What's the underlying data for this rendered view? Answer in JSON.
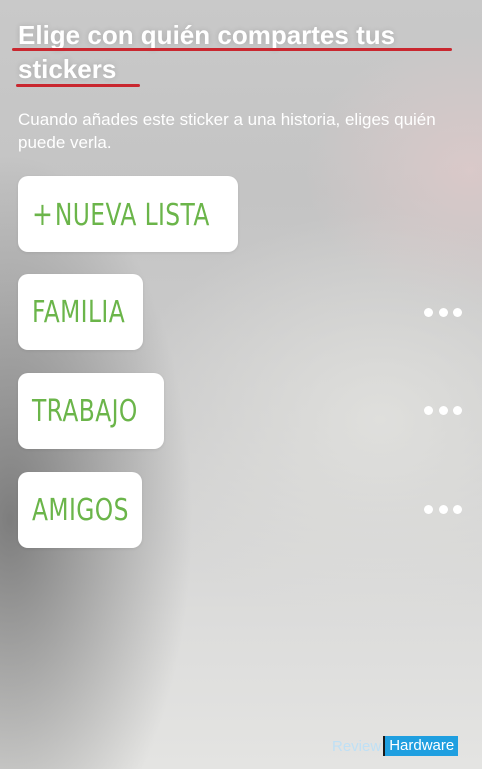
{
  "header": {
    "title": "Elige con quién compartes tus stickers",
    "subtitle": "Cuando añades este sticker a una historia, eliges quién puede verla."
  },
  "new_list_button": {
    "icon": "+",
    "label": "NUEVA LISTA"
  },
  "lists": [
    {
      "label": "FAMILIA"
    },
    {
      "label": "TRABAJO"
    },
    {
      "label": "AMIGOS"
    }
  ],
  "watermark": {
    "part1": "Review",
    "part2": "Hardware"
  },
  "colors": {
    "accent_green": "#6bb54a",
    "underline_red": "#c9272f",
    "watermark_blue": "#1f9fe0"
  }
}
